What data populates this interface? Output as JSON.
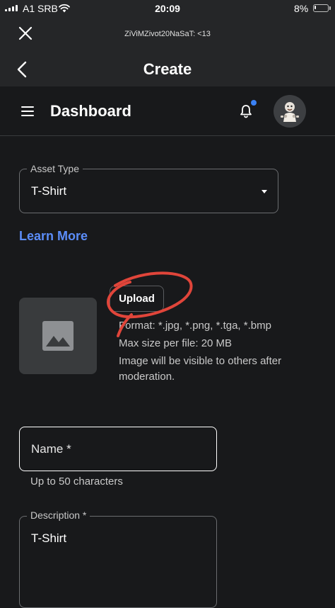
{
  "status_bar": {
    "carrier": "A1 SRB",
    "time": "20:09",
    "battery_percent": "8%",
    "battery_level": 0.08,
    "icons": [
      "signal-icon",
      "wifi-icon",
      "battery-icon"
    ]
  },
  "browser": {
    "url_title": "ZiViMZivot20NaSaT: <13",
    "page_title": "Create",
    "icons": [
      "close-icon",
      "chevron-left-icon"
    ]
  },
  "dashboard": {
    "title": "Dashboard",
    "icons": [
      "hamburger-menu-icon",
      "bell-icon",
      "avatar"
    ],
    "notification_dot_color": "#3b82f6"
  },
  "asset_type": {
    "label": "Asset Type",
    "value": "T-Shirt"
  },
  "learn_more": "Learn More",
  "upload": {
    "button_label": "Upload",
    "format_line": "Format: *.jpg, *.png, *.tga, *.bmp",
    "max_size_line": "Max size per file: 20 MB",
    "visibility_line_1": "Image will be visible to others after",
    "visibility_line_2": "moderation.",
    "icon": "image-placeholder-icon"
  },
  "name_field": {
    "placeholder": "Name *",
    "helper": "Up to 50 characters"
  },
  "description_field": {
    "label": "Description *",
    "value": "T-Shirt"
  },
  "colors": {
    "background": "#18191b",
    "accent": "#5b8df9",
    "annotation": "#e0453a"
  }
}
